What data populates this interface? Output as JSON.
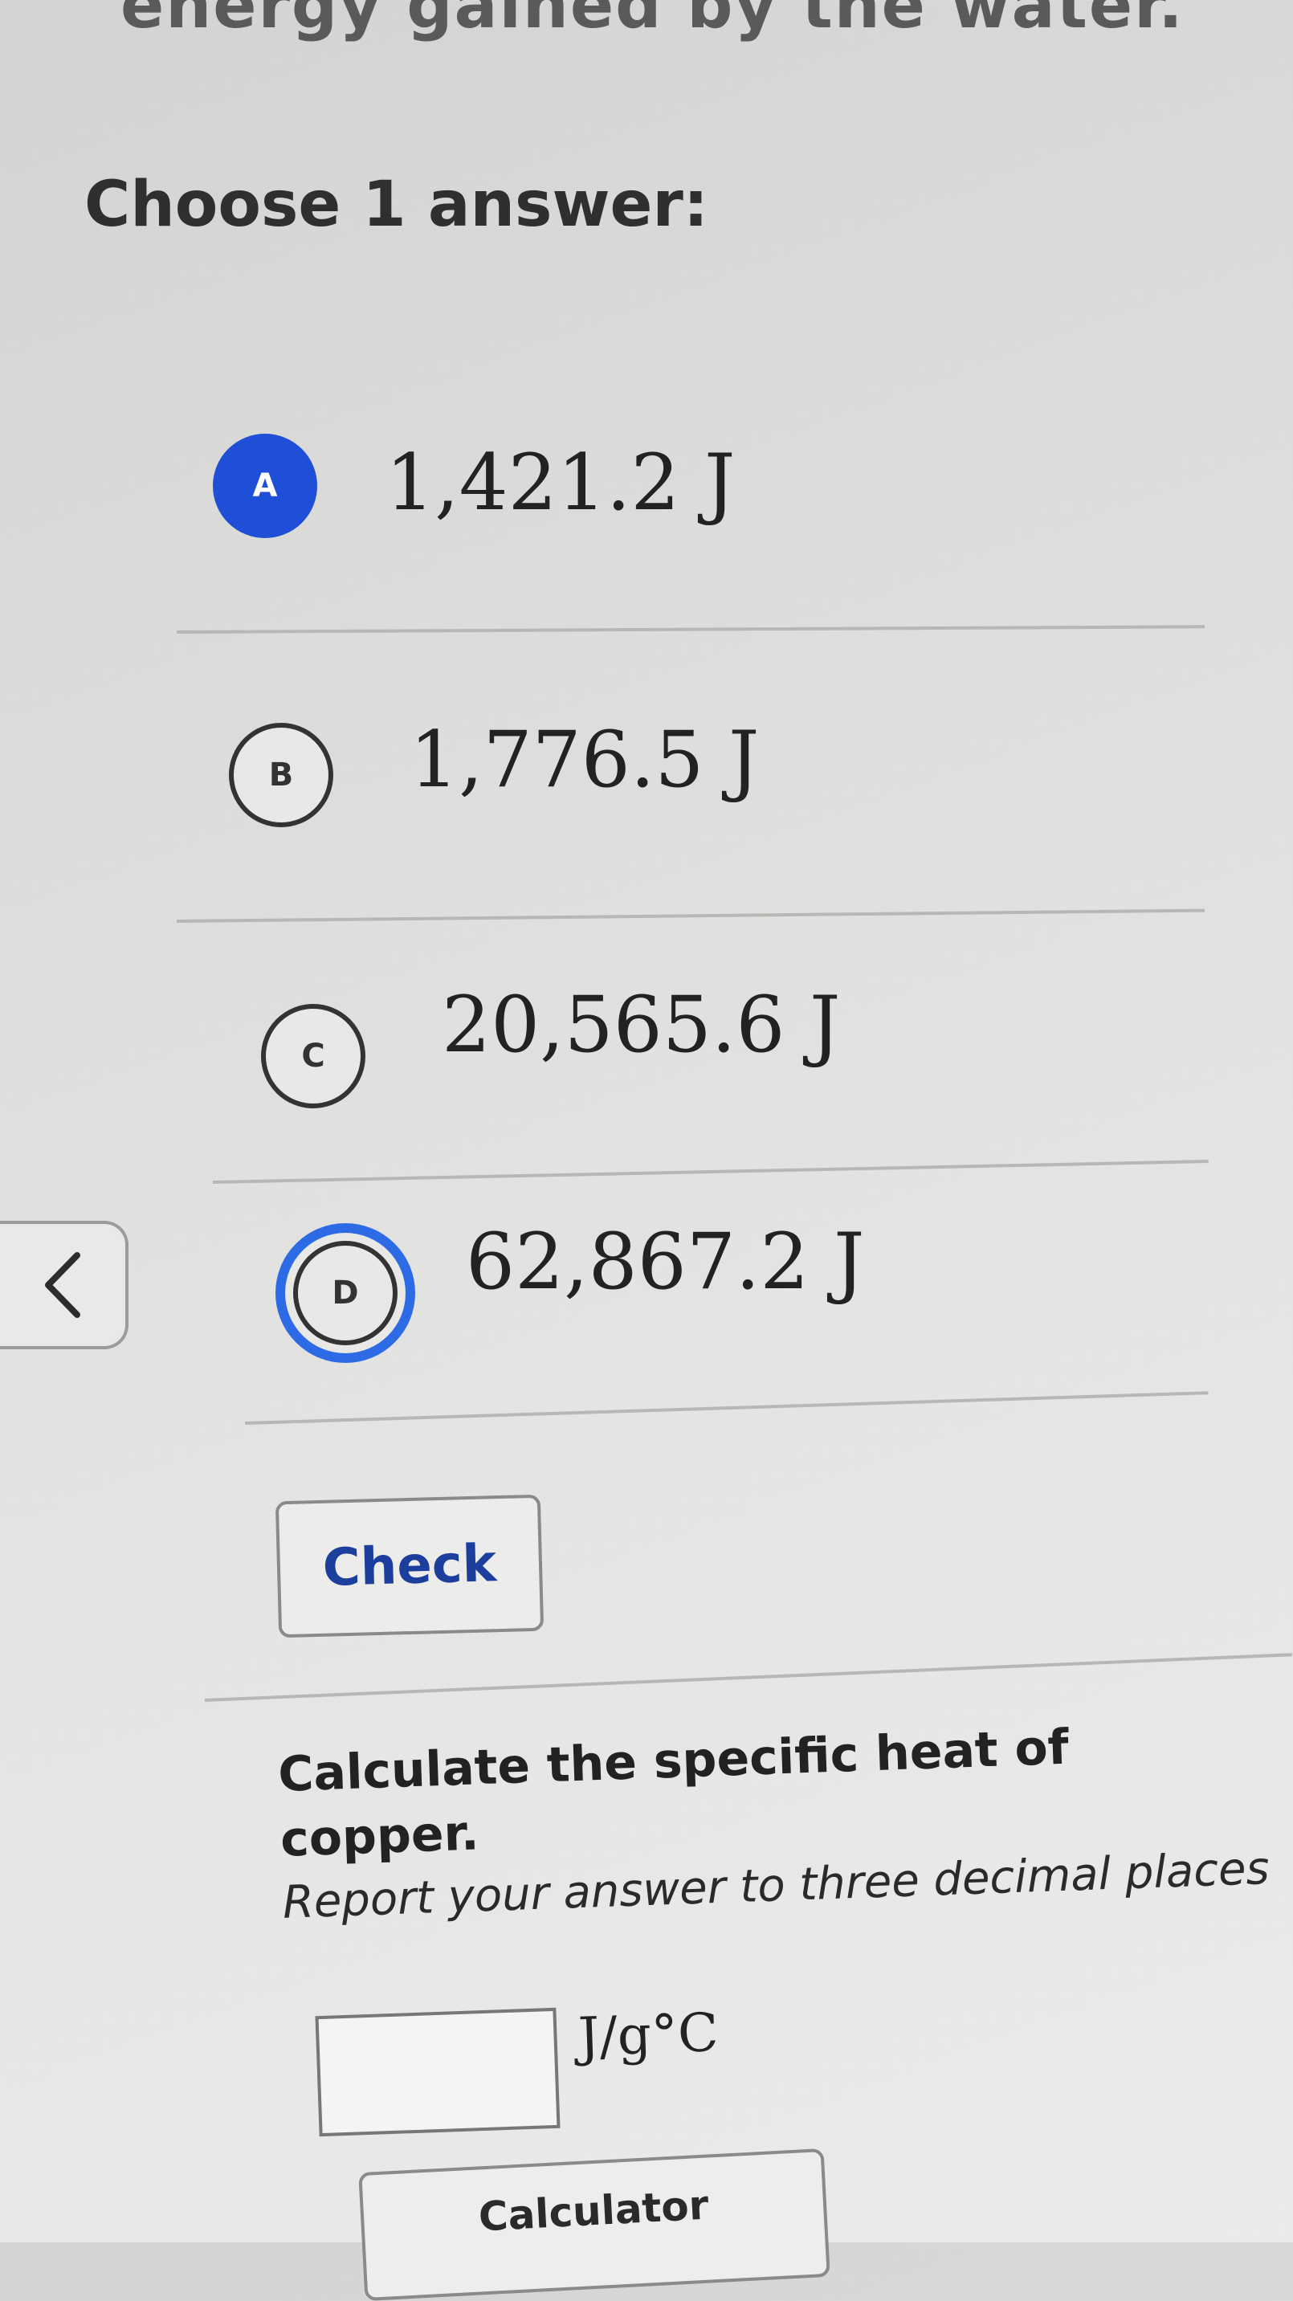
{
  "header_fragment": "energy gained by the water.",
  "prompt": "Choose 1 answer:",
  "choices": [
    {
      "letter": "A",
      "text": "1,421.2 J"
    },
    {
      "letter": "B",
      "text": "1,776.5 J"
    },
    {
      "letter": "C",
      "text": "20,565.6 J"
    },
    {
      "letter": "D",
      "text": "62,867.2 J"
    }
  ],
  "check_label": "Check",
  "question": {
    "title": "Calculate the specific heat of copper.",
    "instruction": "Report your answer to three decimal places",
    "unit": "J/g°C",
    "input_value": ""
  },
  "calculator_label": "Calculator",
  "colors": {
    "accent": "#1f4fd6",
    "focus_ring": "#2d6be6",
    "check_text": "#1c3f9e"
  },
  "icons": {
    "back": "chevron-left-icon"
  }
}
